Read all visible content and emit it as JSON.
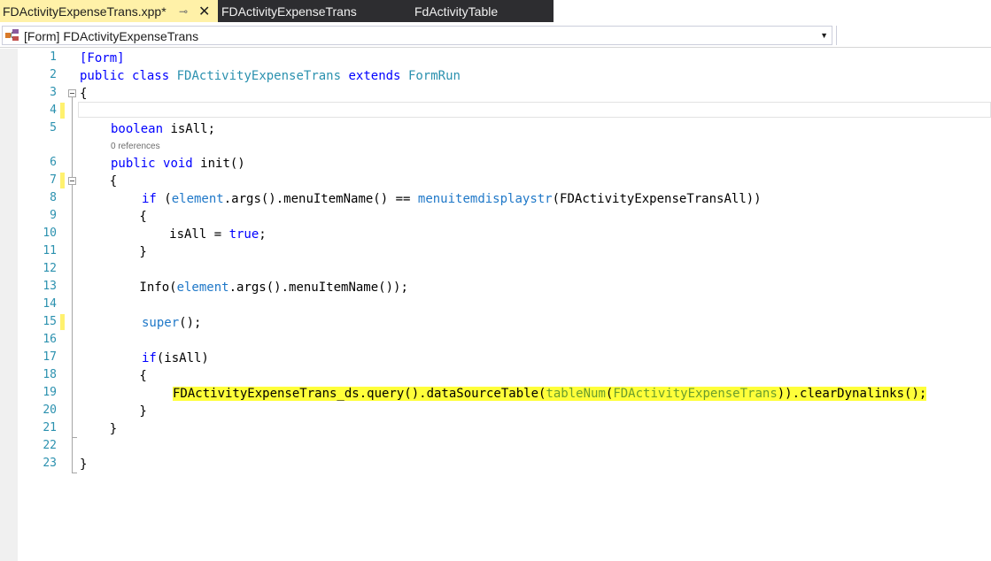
{
  "tabs": [
    {
      "label": "FDActivityExpenseTrans.xpp*",
      "active": true
    },
    {
      "label": "FDActivityExpenseTrans",
      "active": false
    },
    {
      "label": "FdActivityTable",
      "active": false
    }
  ],
  "tab_pin_glyph": "⊸",
  "tab_close_glyph": "✕",
  "navbar": {
    "selected": "[Form] FDActivityExpenseTrans",
    "dropdown_glyph": "▼"
  },
  "editor": {
    "line_numbers": [
      "1",
      "2",
      "3",
      "4",
      "5",
      "6",
      "7",
      "8",
      "9",
      "10",
      "11",
      "12",
      "13",
      "14",
      "15",
      "16",
      "17",
      "18",
      "19",
      "20",
      "21",
      "22",
      "23"
    ],
    "references_lens": "0 references",
    "code": {
      "l1": "[Form]",
      "l2_kw1": "public",
      "l2_kw2": "class",
      "l2_name": "FDActivityExpenseTrans",
      "l2_kw3": "extends",
      "l2_base": "FormRun",
      "l3": "{",
      "l5_type": "boolean",
      "l5_rest": " isAll;",
      "l6_kw1": "public",
      "l6_kw2": "void",
      "l6_rest": " init()",
      "l7": "    {",
      "l8_kw": "if",
      "l8_a": " (",
      "l8_element": "element",
      "l8_b": ".args().menuItemName() == ",
      "l8_fn": "menuitemdisplaystr",
      "l8_c": "(FDActivityExpenseTransAll))",
      "l9": "        {",
      "l10_a": "            isAll = ",
      "l10_kw": "true",
      "l10_b": ";",
      "l11": "        }",
      "l13_a": "        Info(",
      "l13_element": "element",
      "l13_b": ".args().menuItemName());",
      "l15_kw": "super",
      "l15_b": "();",
      "l17_kw": "if",
      "l17_b": "(isAll)",
      "l18": "        {",
      "l19_a": "FDActivityExpenseTrans_ds.query().dataSourceTable(",
      "l19_fn": "tableNum",
      "l19_b": "(",
      "l19_tbl": "FDActivityExpenseTrans",
      "l19_c": ")).clearDynalinks();",
      "l20": "        }",
      "l21": "    }",
      "l23": "}"
    }
  },
  "colors": {
    "keyword": "#0000ff",
    "type": "#2b91af",
    "highlight": "#ffff3a",
    "tab_active": "#fff1a8",
    "tab_inactive": "#2d2d30"
  }
}
